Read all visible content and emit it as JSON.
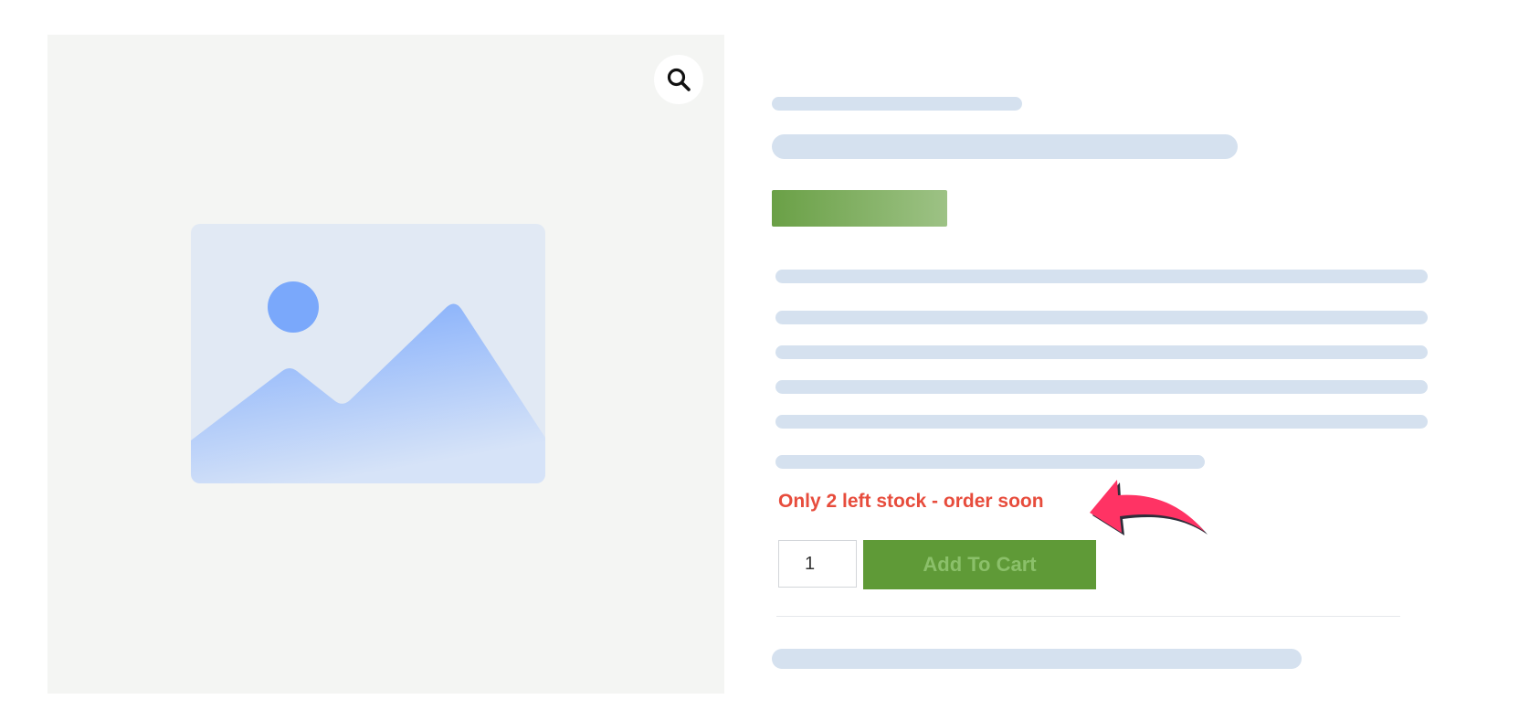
{
  "gallery": {
    "zoom_icon": "search-icon",
    "image_icon": "image-placeholder-icon"
  },
  "product": {
    "stock_message": "Only 2 left stock - order soon",
    "quantity_value": "1",
    "add_to_cart_label": "Add To Cart"
  },
  "colors": {
    "stock_message": "#e74c3c",
    "add_to_cart_bg": "#5f9a37",
    "price_bar": "#6aa046",
    "skeleton": "#d5e1ef",
    "arrow": "#ff3364"
  }
}
